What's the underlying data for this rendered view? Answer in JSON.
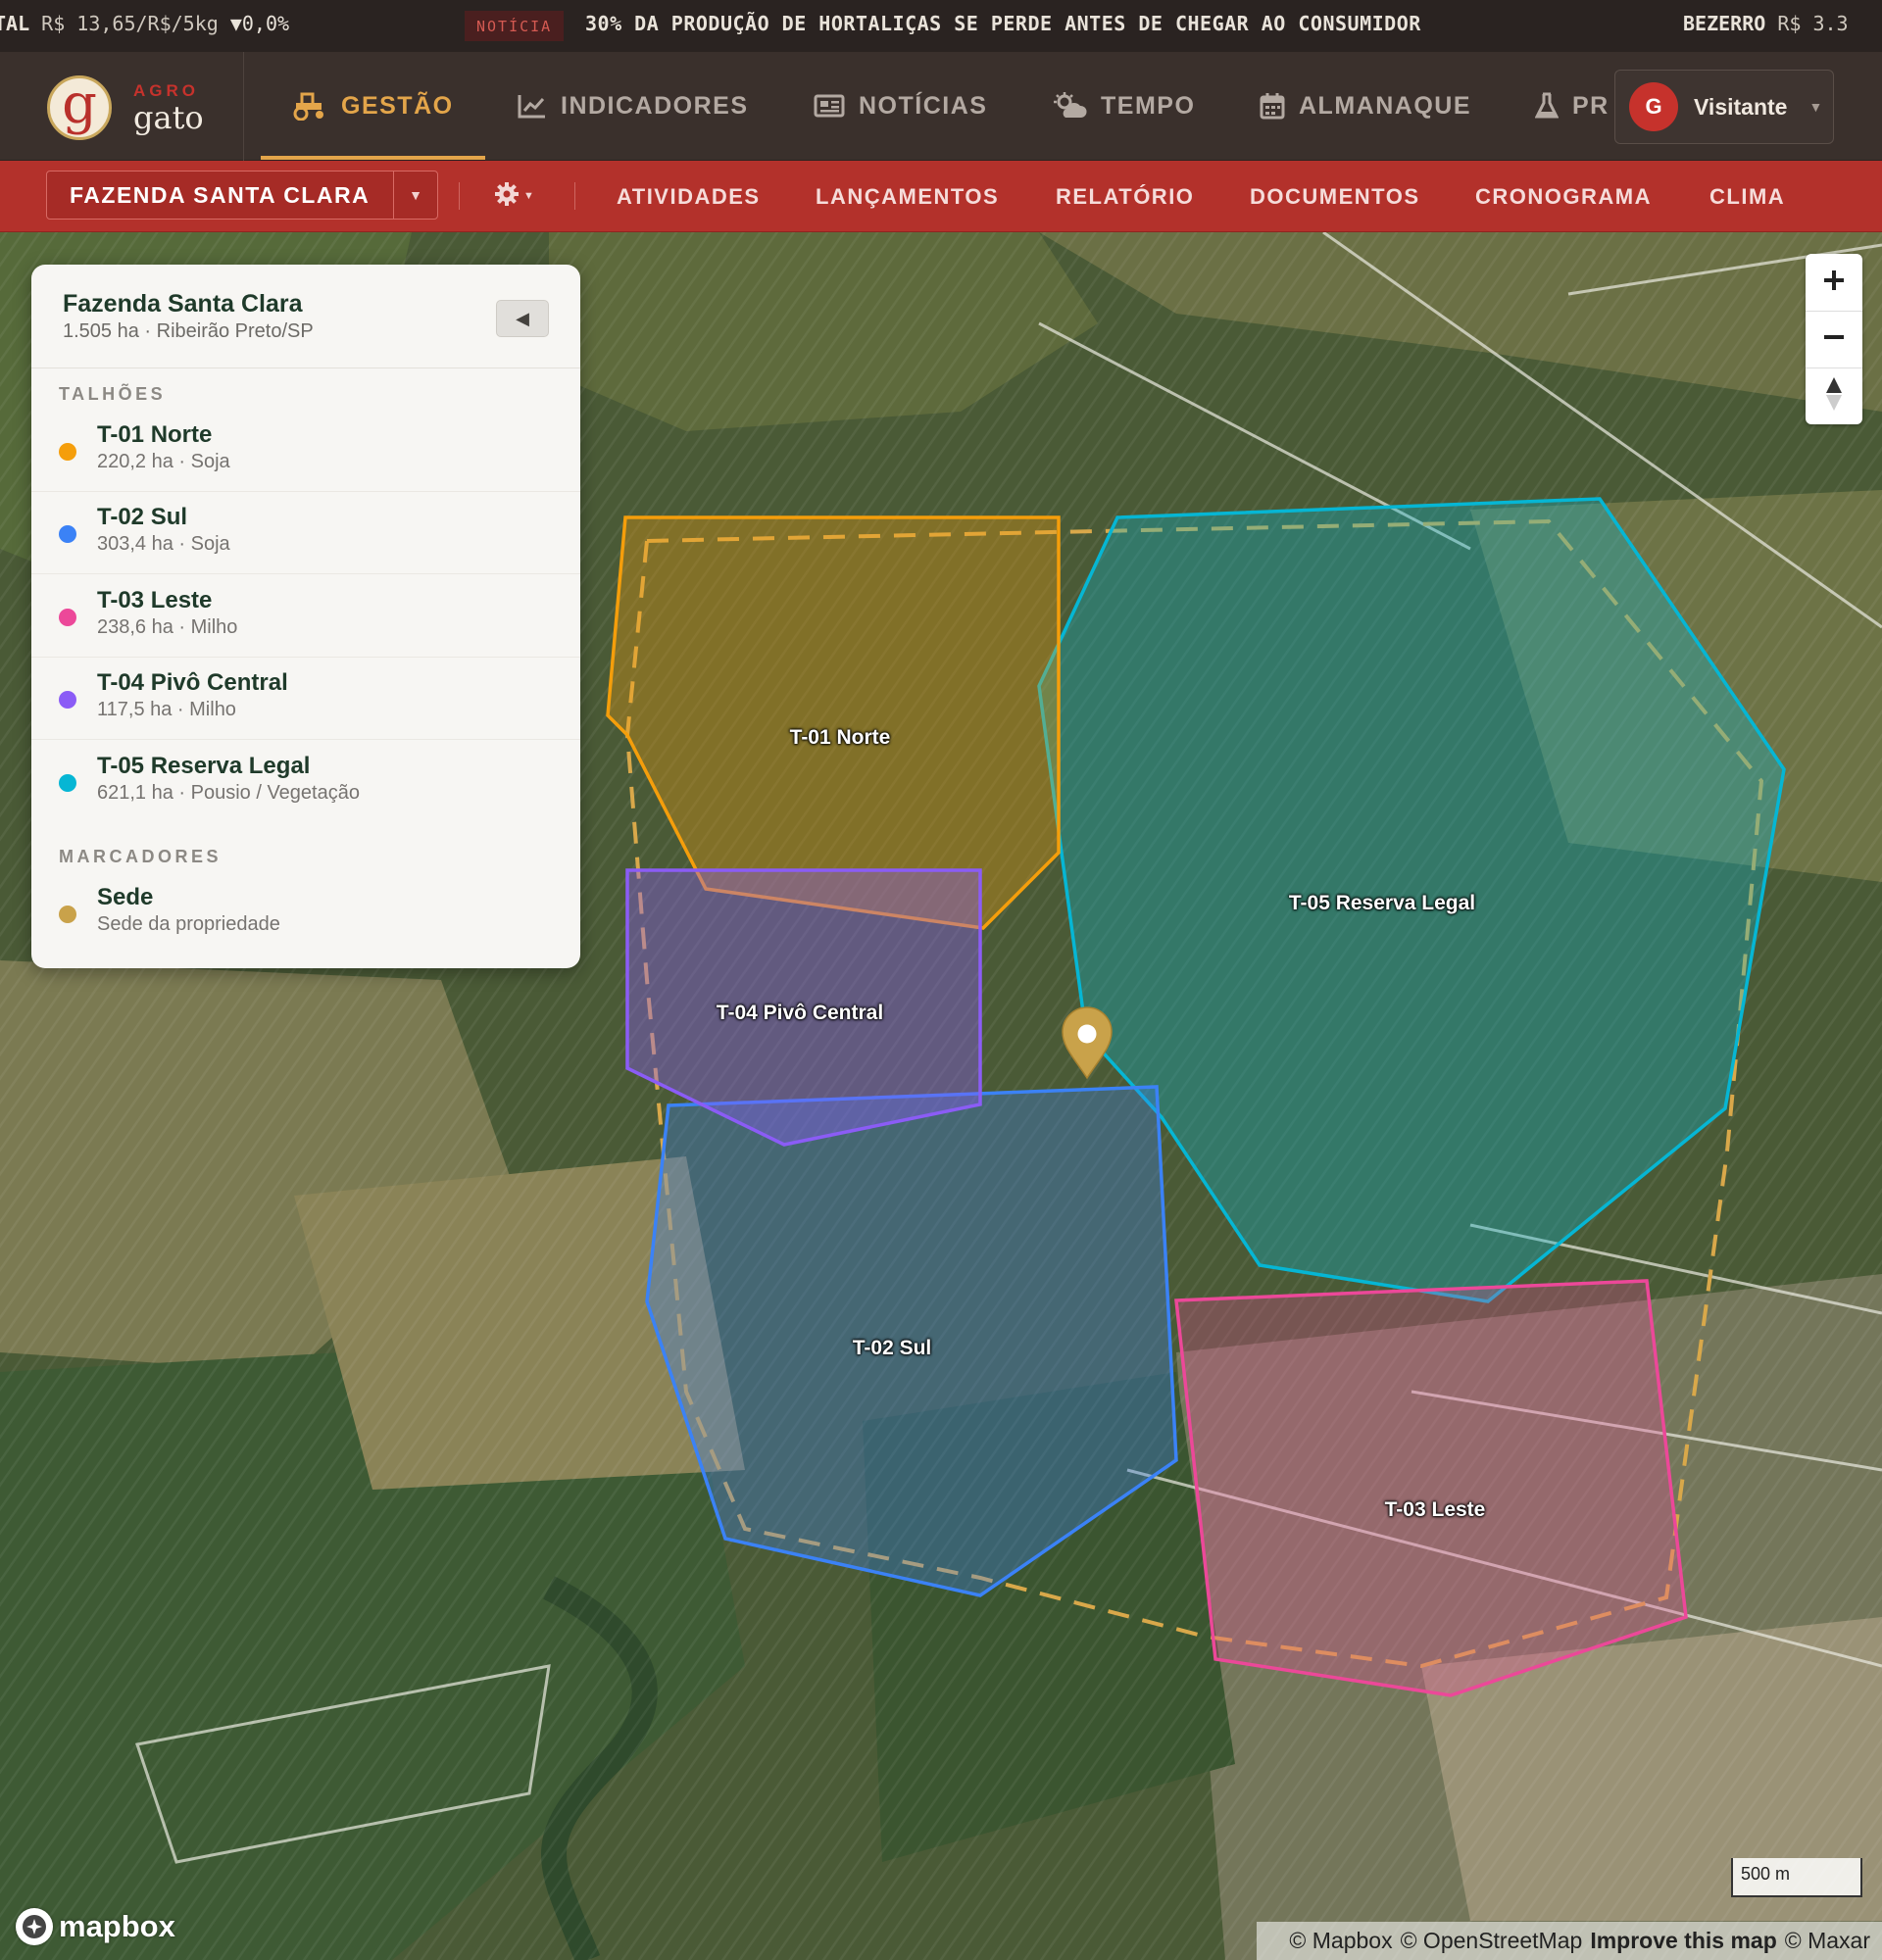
{
  "ticker": {
    "left_label": "TAL",
    "left_price": "R$ 13,65/R$/5kg",
    "left_delta": "▼0,0%",
    "news_badge": "NOTÍCIA",
    "headline": "30% DA PRODUÇÃO DE HORTALIÇAS SE PERDE ANTES DE CHEGAR AO CONSUMIDOR",
    "right_label": "BEZERRO",
    "right_price": "R$ 3.3"
  },
  "logo": {
    "agro": "AGRO",
    "gato": "gato",
    "mark": "g"
  },
  "nav": {
    "items": [
      {
        "label": "GESTÃO",
        "icon": "tractor-icon",
        "active": true
      },
      {
        "label": "INDICADORES",
        "icon": "chart-line-icon"
      },
      {
        "label": "NOTÍCIAS",
        "icon": "newspaper-icon"
      },
      {
        "label": "TEMPO",
        "icon": "cloud-sun-icon"
      },
      {
        "label": "ALMANAQUE",
        "icon": "calendar-icon"
      },
      {
        "label": "PR",
        "icon": "flask-icon"
      }
    ],
    "user": {
      "initial": "G",
      "name": "Visitante"
    }
  },
  "subnav": {
    "farm_select": "FAZENDA SANTA CLARA",
    "items": [
      "ATIVIDADES",
      "LANÇAMENTOS",
      "RELATÓRIO",
      "DOCUMENTOS",
      "CRONOGRAMA",
      "CLIMA"
    ]
  },
  "panel": {
    "farm_name": "Fazenda Santa Clara",
    "farm_meta": "1.505 ha · Ribeirão Preto/SP",
    "plots_title": "TALHÕES",
    "plots": [
      {
        "name": "T-01 Norte",
        "meta": "220,2 ha · Soja",
        "color": "#f59e0b"
      },
      {
        "name": "T-02 Sul",
        "meta": "303,4 ha · Soja",
        "color": "#3b82f6"
      },
      {
        "name": "T-03 Leste",
        "meta": "238,6 ha · Milho",
        "color": "#ec4899"
      },
      {
        "name": "T-04 Pivô Central",
        "meta": "117,5 ha · Milho",
        "color": "#8b5cf6"
      },
      {
        "name": "T-05 Reserva Legal",
        "meta": "621,1 ha · Pousio / Vegetação",
        "color": "#06b6d4"
      }
    ],
    "markers_title": "MARCADORES",
    "markers": [
      {
        "name": "Sede",
        "meta": "Sede da propriedade",
        "color": "#c9a24a"
      }
    ]
  },
  "map": {
    "labels": [
      "T-01 Norte",
      "T-04 Pivô Central",
      "T-05 Reserva Legal",
      "T-02 Sul",
      "T-03 Leste"
    ],
    "scale": "500 m",
    "logo": "mapbox",
    "attribution": {
      "mapbox": "© Mapbox",
      "osm": "© OpenStreetMap",
      "improve": "Improve this map",
      "maxar": "© Maxar"
    }
  }
}
